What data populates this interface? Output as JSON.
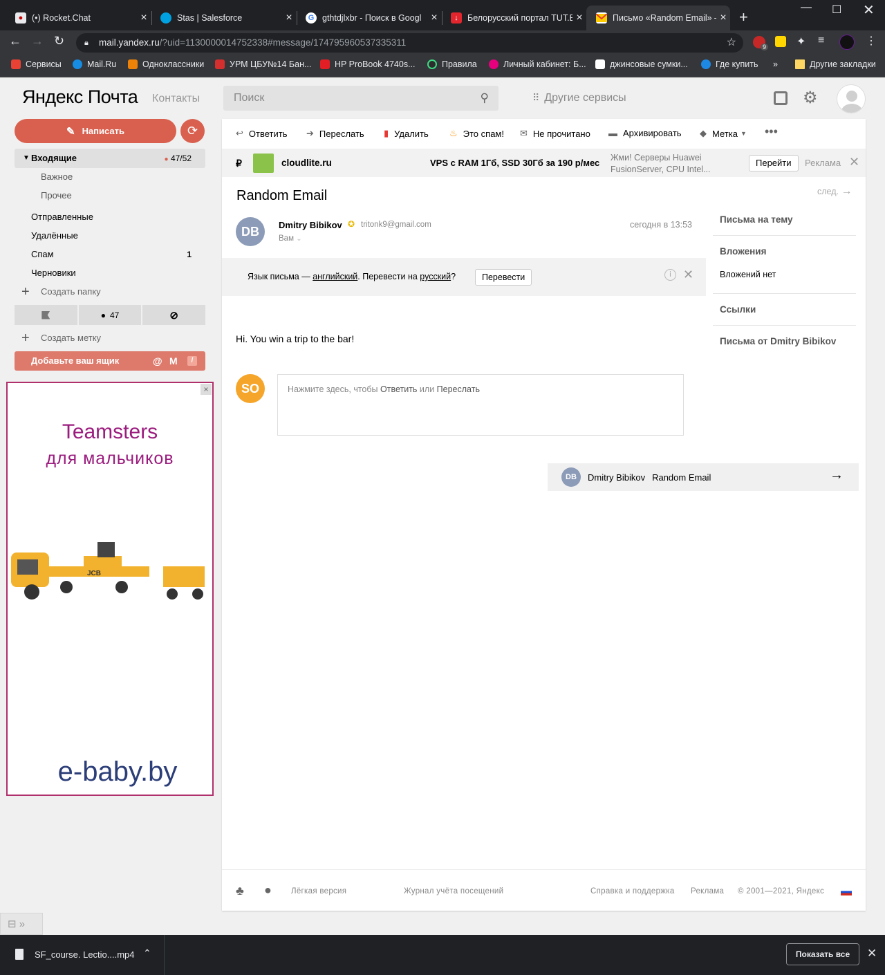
{
  "browser": {
    "tabs": [
      {
        "title": "(•) Rocket.Chat",
        "icon": "rocket-chat-icon"
      },
      {
        "title": "Stas | Salesforce",
        "icon": "salesforce-icon"
      },
      {
        "title": "gthtdjlxbr - Поиск в Googl",
        "icon": "google-icon"
      },
      {
        "title": "Белорусский портал TUT.B",
        "icon": "tut-by-icon"
      },
      {
        "title": "Письмо «Random Email» –",
        "icon": "yandex-mail-icon",
        "active": true
      }
    ],
    "url_host": "mail.yandex.ru",
    "url_path": "/?uid=1130000014752338#message/174795960537335311",
    "extension_badge": "9",
    "bookmarks": [
      {
        "label": "Сервисы",
        "color": "#e94235"
      },
      {
        "label": "Mail.Ru",
        "color": "#168de2"
      },
      {
        "label": "Одноклассники",
        "color": "#ee8208"
      },
      {
        "label": "УРМ ЦБУ№14 Бан...",
        "color": "#d32f2f"
      },
      {
        "label": "HP ProBook 4740s...",
        "color": "#e31e24"
      },
      {
        "label": "Правила",
        "color": "#1a1a1a"
      },
      {
        "label": "Личный кабинет: Б...",
        "color": "#e6007e"
      },
      {
        "label": "джинсовые сумки...",
        "color": "#ffffff"
      },
      {
        "label": "Где купить",
        "color": "#1e88e5"
      }
    ],
    "more_bookmarks_label": "»",
    "other_bookmarks_label": "Другие закладки"
  },
  "header": {
    "logo_brand": "Яндекс",
    "logo_product": "Почта",
    "contacts_label": "Контакты",
    "search_placeholder": "Поиск",
    "other_services_label": "Другие сервисы"
  },
  "sidebar": {
    "compose_label": "Написать",
    "inbox": {
      "label": "Входящие",
      "unread": "47",
      "total": "52"
    },
    "inbox_subfolders": [
      "Важное",
      "Прочее"
    ],
    "folders": [
      {
        "label": "Отправленные",
        "count": ""
      },
      {
        "label": "Удалённые",
        "count": ""
      },
      {
        "label": "Спам",
        "count": "1"
      },
      {
        "label": "Черновики",
        "count": ""
      }
    ],
    "create_folder_label": "Создать папку",
    "filter_unread_count": "47",
    "create_label_label": "Создать метку",
    "add_mailbox_label": "Добавьте ваш ящик"
  },
  "ad_banner": {
    "title_line1": "Teamsters",
    "title_line2": "для мальчиков",
    "site": "e-baby.by",
    "toy_brand": "JCB"
  },
  "actions": [
    {
      "label": "Ответить",
      "icon": "reply-icon"
    },
    {
      "label": "Переслать",
      "icon": "forward-icon"
    },
    {
      "label": "Удалить",
      "icon": "trash-icon"
    },
    {
      "label": "Это спам!",
      "icon": "fire-icon"
    },
    {
      "label": "Не прочитано",
      "icon": "envelope-icon"
    },
    {
      "label": "Архивировать",
      "icon": "archive-icon"
    },
    {
      "label": "Метка",
      "icon": "tag-icon"
    }
  ],
  "ad_bar": {
    "currency": "₽",
    "domain": "cloudlite.ru",
    "headline": "VPS с RAM 1Гб, SSD 30Гб за 190 р/мес",
    "text_line1": "Жми! Серверы Huawei",
    "text_line2": "FusionServer, CPU Intel...",
    "go_label": "Перейти",
    "ad_label": "Реклама"
  },
  "message": {
    "subject": "Random Email",
    "next_label": "след.",
    "sender_initials": "DB",
    "sender_name": "Dmitry Bibikov",
    "sender_email": "tritonk9@gmail.com",
    "recipient_label": "Вам",
    "date": "сегодня в 13:53",
    "translate": {
      "prefix": "Язык письма — ",
      "lang": "английский",
      "middle": ". Перевести на ",
      "target": "русский",
      "suffix": "?",
      "button": "Перевести"
    },
    "body": "Hi. You win a trip to the bar!",
    "user_initials": "SO",
    "reply_prefix": "Нажмите здесь, чтобы ",
    "reply_link": "Ответить",
    "reply_or": " или ",
    "forward_link": "Переслать",
    "thread": {
      "initials": "DB",
      "name": "Dmitry Bibikov",
      "subject": "Random Email"
    }
  },
  "right_panel": {
    "thread_title": "Письма на тему",
    "attachments_title": "Вложения",
    "attachments_value": "Вложений нет",
    "links_title": "Ссылки",
    "from_title": "Письма от Dmitry Bibikov"
  },
  "footer": {
    "lite": "Лёгкая версия",
    "journal": "Журнал учёта посещений",
    "help": "Справка и поддержка",
    "ads": "Реклама",
    "copyright": "© 2001—2021, Яндекс"
  },
  "download_bar": {
    "file": "SF_course. Lectio....mp4",
    "show_all": "Показать все"
  },
  "colors": {
    "accent": "#d9604f",
    "chrome_dark": "#202124",
    "chrome_mid": "#35363a",
    "ad_border": "#b0306b"
  }
}
